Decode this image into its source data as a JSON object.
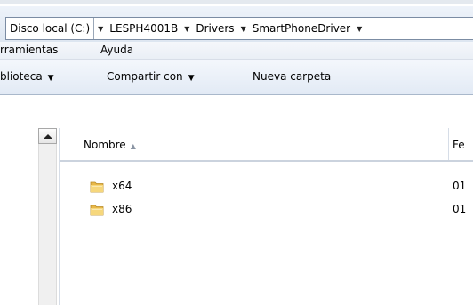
{
  "address_bar": {
    "crumbs": [
      "Disco local (C:)",
      "LESPH4001B",
      "Drivers",
      "SmartPhoneDriver"
    ]
  },
  "menu": {
    "items": [
      "rramientas",
      "Ayuda"
    ]
  },
  "toolbar": {
    "library": "blioteca",
    "share": "Compartir con",
    "new_folder": "Nueva carpeta"
  },
  "file_list": {
    "columns": {
      "name": "Nombre",
      "date": "Fe"
    },
    "rows": [
      {
        "name": "x64",
        "date": "01",
        "icon": "folder-icon"
      },
      {
        "name": "x86",
        "date": "01",
        "icon": "folder-icon"
      }
    ]
  },
  "colors": {
    "folder": "#e8b84a",
    "toolbar_gradient_top": "#f4f7fc",
    "toolbar_gradient_bottom": "#e2eaf5"
  }
}
